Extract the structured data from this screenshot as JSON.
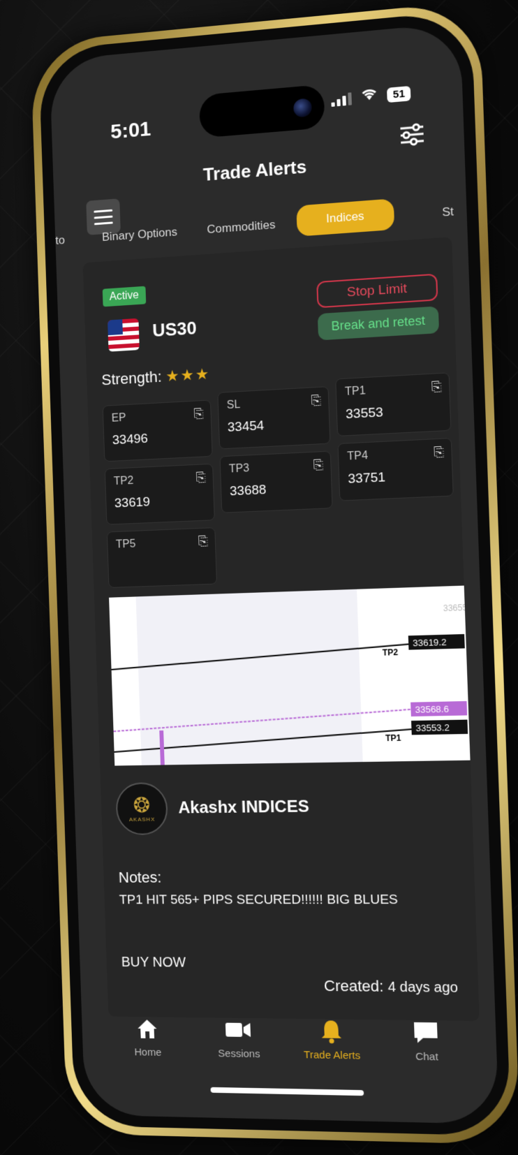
{
  "status": {
    "time": "5:01",
    "battery": "51"
  },
  "header": {
    "title": "Trade Alerts"
  },
  "tabs": [
    {
      "label": "to"
    },
    {
      "label": "Binary Options"
    },
    {
      "label": "Commodities"
    },
    {
      "label": "Indices"
    },
    {
      "label": "St"
    }
  ],
  "alert": {
    "status": "Active",
    "symbol": "US30",
    "order_type": "Stop Limit",
    "strategy": "Break and retest",
    "strength_label": "Strength:",
    "strength_stars": "★★★",
    "levels": [
      {
        "label": "EP",
        "value": "33496"
      },
      {
        "label": "SL",
        "value": "33454"
      },
      {
        "label": "TP1",
        "value": "33553"
      },
      {
        "label": "TP2",
        "value": "33619"
      },
      {
        "label": "TP3",
        "value": "33688"
      },
      {
        "label": "TP4",
        "value": "33751"
      },
      {
        "label": "TP5",
        "value": ""
      }
    ],
    "chart": {
      "price_top": "33655.0",
      "tp2_price": "33619.2",
      "tp2_label": "TP2",
      "current_price": "33568.6",
      "tp1_price": "33553.2",
      "tp1_label": "TP1"
    },
    "provider": {
      "name": "Akashx INDICES",
      "logo_text": "AKASHX"
    },
    "notes_label": "Notes:",
    "notes": "TP1 HIT 565+ PIPS SECURED!!!!!! BIG BLUES",
    "cta": "BUY NOW",
    "created_label": "Created:",
    "created_value": "4 days ago"
  },
  "nav": [
    {
      "label": "Home",
      "icon": "home-icon"
    },
    {
      "label": "Sessions",
      "icon": "video-icon"
    },
    {
      "label": "Trade Alerts",
      "icon": "bell-icon"
    },
    {
      "label": "Chat",
      "icon": "chat-icon"
    }
  ],
  "colors": {
    "accent": "#e6b01e",
    "active": "#3aa655",
    "danger": "#d0364a",
    "purple": "#b86ad6"
  }
}
